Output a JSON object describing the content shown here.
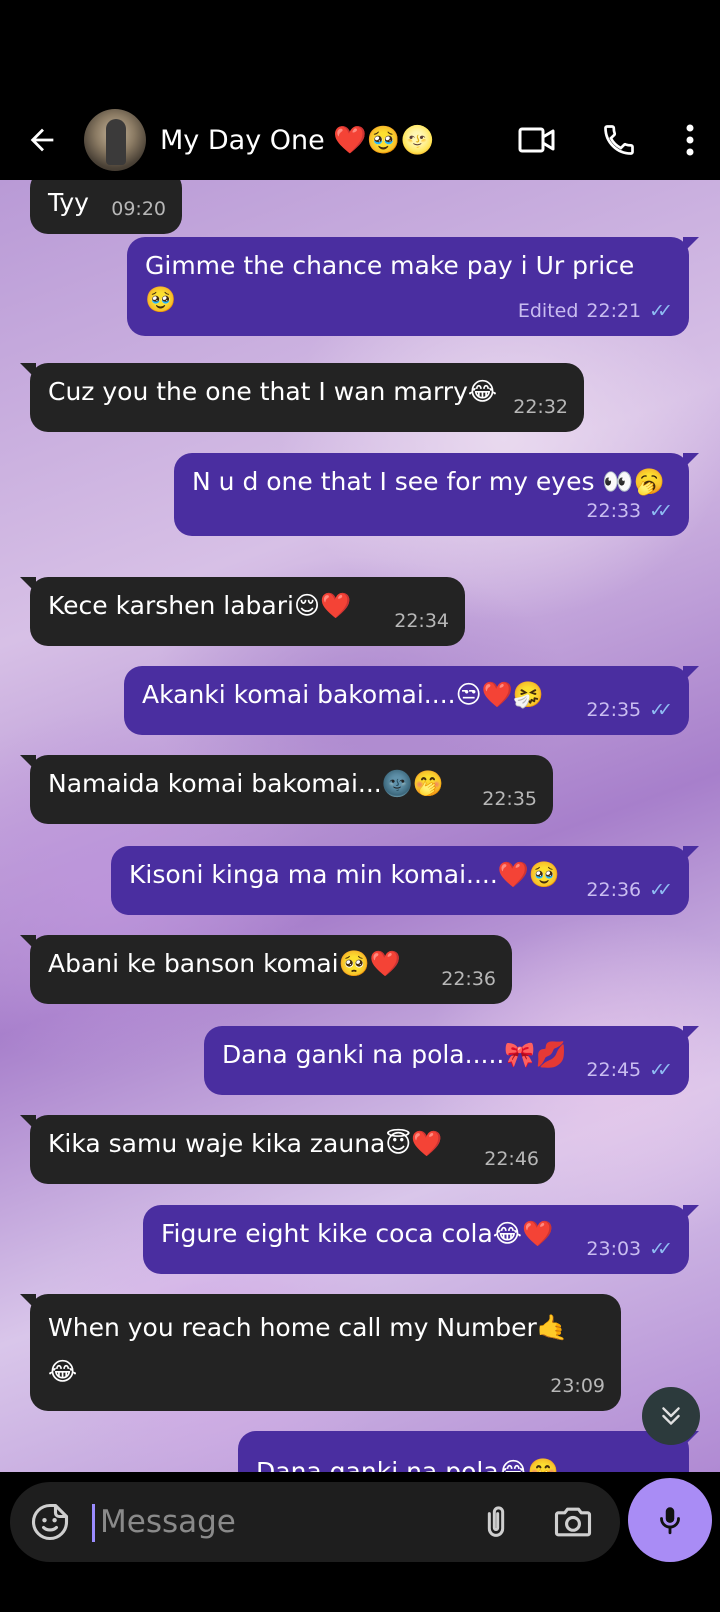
{
  "header": {
    "contact_name": "My Day One ❤️🥹🌝",
    "icons": {
      "back": "arrow-left-icon",
      "video": "video-call-icon",
      "call": "phone-icon",
      "more": "more-vertical-icon"
    }
  },
  "messages": [
    {
      "dir": "in",
      "text": "Tyy",
      "time": "09:20"
    },
    {
      "dir": "out",
      "text": "Gimme the chance make pay i Ur price 🥹",
      "edited": "Edited",
      "time": "22:21",
      "read": true
    },
    {
      "dir": "in",
      "text": "Cuz you the one that I wan marry😂",
      "time": "22:32"
    },
    {
      "dir": "out",
      "text": "N u d one that I see for my eyes 👀🥱",
      "time": "22:33",
      "read": true
    },
    {
      "dir": "in",
      "text": "Kece karshen labari😌❤️",
      "time": "22:34"
    },
    {
      "dir": "out",
      "text": "Akanki komai bakomai....😒❤️🤧",
      "time": "22:35",
      "read": true
    },
    {
      "dir": "in",
      "text": "Namaida komai bakomai...🌚🤭",
      "time": "22:35"
    },
    {
      "dir": "out",
      "text": "Kisoni kinga ma min komai....❤️🥹",
      "time": "22:36",
      "read": true
    },
    {
      "dir": "in",
      "text": "Abani ke banson komai🥺❤️",
      "time": "22:36"
    },
    {
      "dir": "out",
      "text": "Dana ganki na pola.....🎀💋",
      "time": "22:45",
      "read": true
    },
    {
      "dir": "in",
      "text": "Kika samu waje kika zauna😇❤️",
      "time": "22:46"
    },
    {
      "dir": "out",
      "text": "Figure eight kike coca cola😂❤️",
      "time": "23:03",
      "read": true
    },
    {
      "dir": "in",
      "text": "When you reach home call my Number🤙\n😂",
      "time": "23:09"
    },
    {
      "dir": "out",
      "text": "Dana ganki na pola😂🤭",
      "time": "",
      "read": false
    }
  ],
  "composer": {
    "placeholder": "Message",
    "icons": {
      "emoji": "sticker-emoji-icon",
      "attach": "paperclip-icon",
      "camera": "camera-icon",
      "mic": "microphone-icon"
    }
  },
  "colors": {
    "incoming_bubble": "#232323",
    "outgoing_bubble": "#4a2ea0",
    "read_ticks": "#8fbcf3",
    "mic_button": "#a98cf5"
  }
}
